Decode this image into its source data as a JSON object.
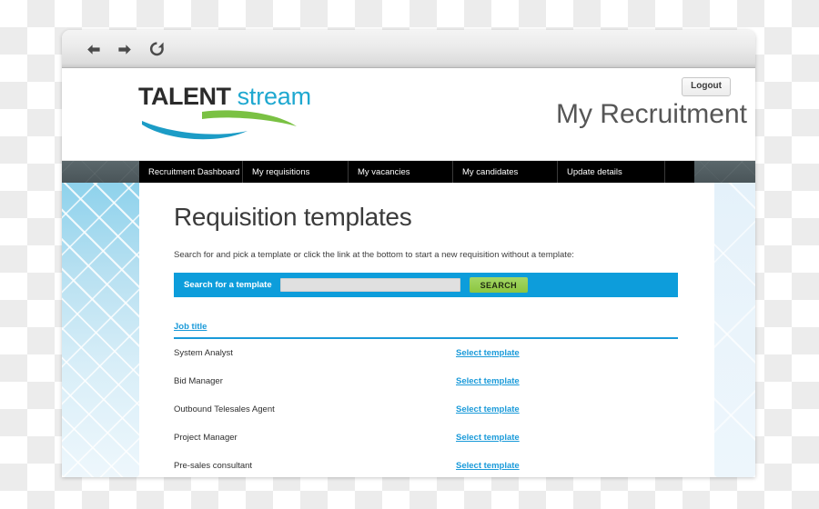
{
  "browser": {
    "back_icon": "arrow-left-icon",
    "forward_icon": "arrow-right-icon",
    "reload_icon": "reload-icon"
  },
  "header": {
    "logo_primary": "TALENT",
    "logo_secondary": "stream",
    "logout_label": "Logout",
    "page_heading": "My Recruitment"
  },
  "nav": {
    "items": [
      {
        "label": "Recruitment Dashboard"
      },
      {
        "label": "My requisitions"
      },
      {
        "label": "My vacancies"
      },
      {
        "label": "My candidates"
      },
      {
        "label": "Update details"
      },
      {
        "label": ""
      }
    ]
  },
  "main": {
    "title": "Requisition templates",
    "subtitle": "Search for and pick a template or click the link at the bottom to start a new requisition without a template:",
    "search": {
      "label": "Search for a template",
      "value": "",
      "placeholder": "",
      "button_label": "SEARCH"
    },
    "table": {
      "column_header": "Job title",
      "action_label": "Select template",
      "rows": [
        {
          "job_title": "System Analyst",
          "action": "Select template"
        },
        {
          "job_title": "Bid Manager",
          "action": "Select template"
        },
        {
          "job_title": "Outbound Telesales Agent",
          "action": "Select template"
        },
        {
          "job_title": "Project Manager",
          "action": "Select template"
        },
        {
          "job_title": "Pre-sales consultant",
          "action": "Select template"
        }
      ]
    }
  },
  "colors": {
    "brand_blue": "#0d9ddb",
    "brand_green": "#8cc63f",
    "logo_teal": "#1fa8d0",
    "logo_green": "#7ac143",
    "nav_black": "#000000",
    "nav_bar": "#4e5a5e",
    "link_blue": "#1a9ad9"
  }
}
